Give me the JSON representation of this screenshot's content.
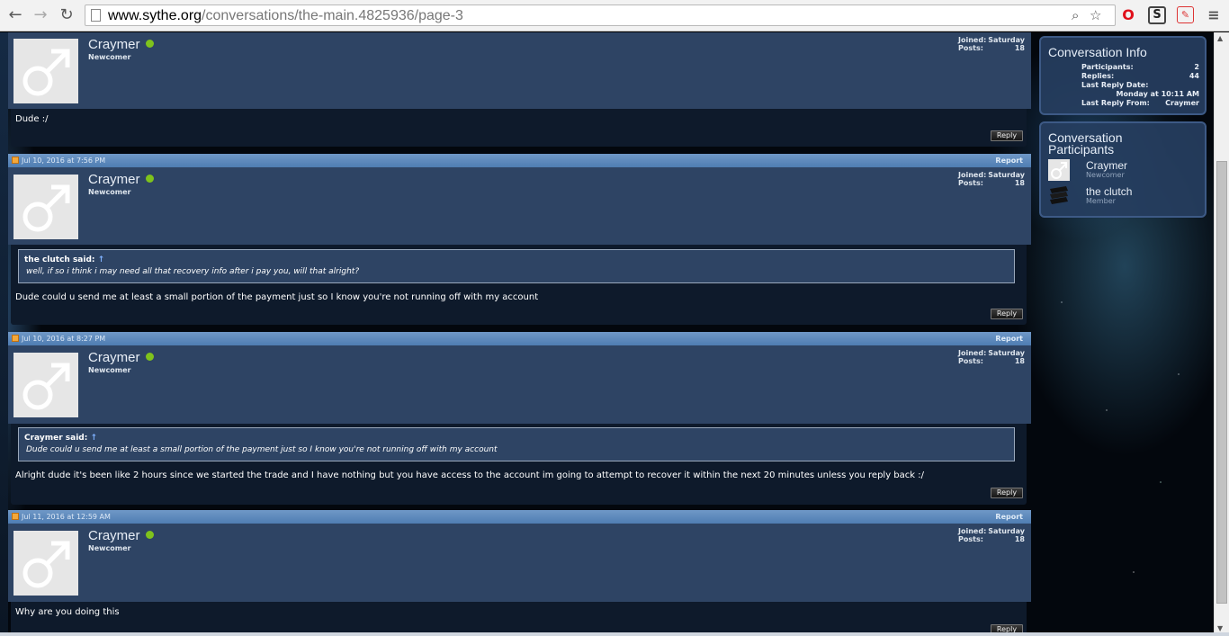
{
  "browser": {
    "url_host": "www.sythe.org",
    "url_path": "/conversations/the-main.4825936/page-3"
  },
  "top_post": {
    "username": "Craymer",
    "user_title": "Newcomer",
    "joined_label": "Joined:",
    "joined_value": "Saturday",
    "posts_label": "Posts:",
    "posts_value": "18",
    "body": "Dude :/",
    "reply_label": "Reply"
  },
  "messages": [
    {
      "date": "Jul 10, 2016 at 7:56 PM",
      "report_label": "Report",
      "username": "Craymer",
      "user_title": "Newcomer",
      "joined_label": "Joined:",
      "joined_value": "Saturday",
      "posts_label": "Posts:",
      "posts_value": "18",
      "quote_author": "the clutch said:",
      "quote_arrow": "↑",
      "quote_text": "well, if so i think i may need all that recovery info after i pay you, will that alright?",
      "body": "Dude could u send me at least a small portion of the payment just so I know you're not running off with my account",
      "reply_label": "Reply"
    },
    {
      "date": "Jul 10, 2016 at 8:27 PM",
      "report_label": "Report",
      "username": "Craymer",
      "user_title": "Newcomer",
      "joined_label": "Joined:",
      "joined_value": "Saturday",
      "posts_label": "Posts:",
      "posts_value": "18",
      "quote_author": "Craymer said:",
      "quote_arrow": "↑",
      "quote_text": "Dude could u send me at least a small portion of the payment just so I know you're not running off with my account",
      "body": "Alright dude it's been like 2 hours since we started the trade and I have nothing but you have access to the account im going to attempt to recover it within the next 20 minutes unless you reply back :/",
      "reply_label": "Reply"
    },
    {
      "date": "Jul 11, 2016 at 12:59 AM",
      "report_label": "Report",
      "username": "Craymer",
      "user_title": "Newcomer",
      "joined_label": "Joined:",
      "joined_value": "Saturday",
      "posts_label": "Posts:",
      "posts_value": "18",
      "body": "Why are you doing this",
      "reply_label": "Reply"
    }
  ],
  "sidebar": {
    "info": {
      "title": "Conversation Info",
      "participants_label": "Participants:",
      "participants_value": "2",
      "replies_label": "Replies:",
      "replies_value": "44",
      "last_reply_date_label": "Last Reply Date:",
      "last_reply_date_value": "Monday at 10:11 AM",
      "last_reply_from_label": "Last Reply From:",
      "last_reply_from_value": "Craymer"
    },
    "participants": {
      "title_line1": "Conversation",
      "title_line2": "Participants",
      "list": [
        {
          "name": "Craymer",
          "title": "Newcomer"
        },
        {
          "name": "the clutch",
          "title": "Member"
        }
      ]
    }
  },
  "colors": {
    "header_bar": "#5a88bd",
    "post_bg": "#2e4464",
    "body_bg": "#0e1a2b",
    "online": "#7fc31c"
  }
}
